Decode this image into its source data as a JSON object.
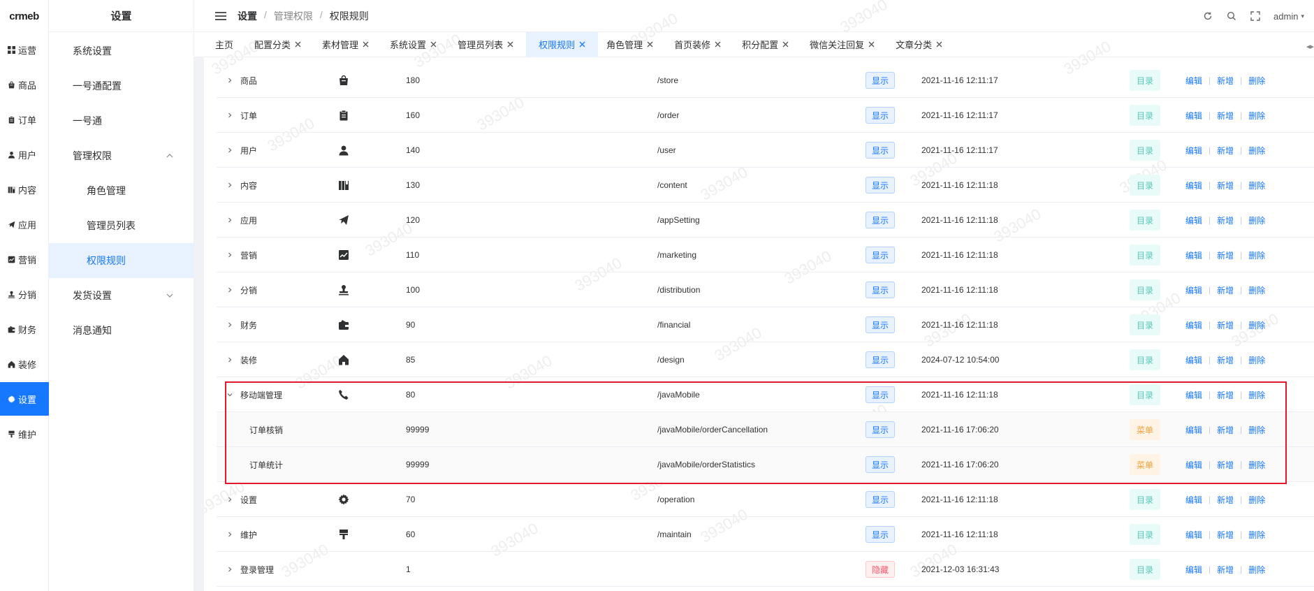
{
  "app": {
    "logo": "crmeb"
  },
  "rail": {
    "items": [
      {
        "label": "运营",
        "icon": "grid-icon"
      },
      {
        "label": "商品",
        "icon": "bag-icon"
      },
      {
        "label": "订单",
        "icon": "clipboard-icon"
      },
      {
        "label": "用户",
        "icon": "user-icon"
      },
      {
        "label": "内容",
        "icon": "book-icon"
      },
      {
        "label": "应用",
        "icon": "plane-icon"
      },
      {
        "label": "营销",
        "icon": "chart-icon"
      },
      {
        "label": "分销",
        "icon": "stamp-icon"
      },
      {
        "label": "财务",
        "icon": "wallet-icon"
      },
      {
        "label": "装修",
        "icon": "home-icon"
      },
      {
        "label": "设置",
        "icon": "gear-icon",
        "active": true
      },
      {
        "label": "维护",
        "icon": "brush-icon"
      }
    ]
  },
  "submenu": {
    "title": "设置",
    "items": [
      {
        "label": "系统设置"
      },
      {
        "label": "一号通配置"
      },
      {
        "label": "一号通"
      },
      {
        "label": "管理权限",
        "caret": "up"
      },
      {
        "label": "角色管理",
        "child": true
      },
      {
        "label": "管理员列表",
        "child": true
      },
      {
        "label": "权限规则",
        "child": true,
        "active": true
      },
      {
        "label": "发货设置",
        "caret": "down"
      },
      {
        "label": "消息通知"
      }
    ]
  },
  "header": {
    "breadcrumb": [
      "设置",
      "管理权限",
      "权限规则"
    ],
    "separator": "/",
    "user": "admin"
  },
  "tabs": [
    {
      "label": "主页",
      "closable": false
    },
    {
      "label": "配置分类",
      "closable": true
    },
    {
      "label": "素材管理",
      "closable": true
    },
    {
      "label": "系统设置",
      "closable": true
    },
    {
      "label": "管理员列表",
      "closable": true
    },
    {
      "label": "权限规则",
      "closable": true,
      "active": true
    },
    {
      "label": "角色管理",
      "closable": true
    },
    {
      "label": "首页装修",
      "closable": true
    },
    {
      "label": "积分配置",
      "closable": true
    },
    {
      "label": "微信关注回复",
      "closable": true
    },
    {
      "label": "文章分类",
      "closable": true
    }
  ],
  "actions": {
    "edit": "编辑",
    "add": "新增",
    "delete": "删除",
    "sep": "|"
  },
  "rows": [
    {
      "name": "商品",
      "icon": "bag-icon",
      "sort": "180",
      "path": "/store",
      "status": "显示",
      "time": "2021-11-16 12:11:17",
      "type": "目录",
      "expand": "right"
    },
    {
      "name": "订单",
      "icon": "clipboard-icon",
      "sort": "160",
      "path": "/order",
      "status": "显示",
      "time": "2021-11-16 12:11:17",
      "type": "目录",
      "expand": "right"
    },
    {
      "name": "用户",
      "icon": "user-icon",
      "sort": "140",
      "path": "/user",
      "status": "显示",
      "time": "2021-11-16 12:11:17",
      "type": "目录",
      "expand": "right"
    },
    {
      "name": "内容",
      "icon": "book-icon",
      "sort": "130",
      "path": "/content",
      "status": "显示",
      "time": "2021-11-16 12:11:18",
      "type": "目录",
      "expand": "right"
    },
    {
      "name": "应用",
      "icon": "plane-icon",
      "sort": "120",
      "path": "/appSetting",
      "status": "显示",
      "time": "2021-11-16 12:11:18",
      "type": "目录",
      "expand": "right"
    },
    {
      "name": "营销",
      "icon": "chart-icon",
      "sort": "110",
      "path": "/marketing",
      "status": "显示",
      "time": "2021-11-16 12:11:18",
      "type": "目录",
      "expand": "right"
    },
    {
      "name": "分销",
      "icon": "stamp-icon",
      "sort": "100",
      "path": "/distribution",
      "status": "显示",
      "time": "2021-11-16 12:11:18",
      "type": "目录",
      "expand": "right"
    },
    {
      "name": "财务",
      "icon": "wallet-icon",
      "sort": "90",
      "path": "/financial",
      "status": "显示",
      "time": "2021-11-16 12:11:18",
      "type": "目录",
      "expand": "right"
    },
    {
      "name": "装修",
      "icon": "home-icon",
      "sort": "85",
      "path": "/design",
      "status": "显示",
      "time": "2024-07-12 10:54:00",
      "type": "目录",
      "expand": "right"
    },
    {
      "name": "移动端管理",
      "icon": "phone-icon",
      "sort": "80",
      "path": "/javaMobile",
      "status": "显示",
      "time": "2021-11-16 12:11:18",
      "type": "目录",
      "expand": "down"
    },
    {
      "name": "订单核销",
      "icon": "",
      "sort": "99999",
      "path": "/javaMobile/orderCancellation",
      "status": "显示",
      "time": "2021-11-16 17:06:20",
      "type": "菜单",
      "child": true
    },
    {
      "name": "订单统计",
      "icon": "",
      "sort": "99999",
      "path": "/javaMobile/orderStatistics",
      "status": "显示",
      "time": "2021-11-16 17:06:20",
      "type": "菜单",
      "child": true
    },
    {
      "name": "设置",
      "icon": "gear-icon",
      "sort": "70",
      "path": "/operation",
      "status": "显示",
      "time": "2021-11-16 12:11:18",
      "type": "目录",
      "expand": "right"
    },
    {
      "name": "维护",
      "icon": "brush-icon",
      "sort": "60",
      "path": "/maintain",
      "status": "显示",
      "time": "2021-11-16 12:11:18",
      "type": "目录",
      "expand": "right"
    },
    {
      "name": "登录管理",
      "icon": "",
      "sort": "1",
      "path": "",
      "status": "隐藏",
      "time": "2021-12-03 16:31:43",
      "type": "目录",
      "expand": "right"
    }
  ],
  "watermark": "393040"
}
